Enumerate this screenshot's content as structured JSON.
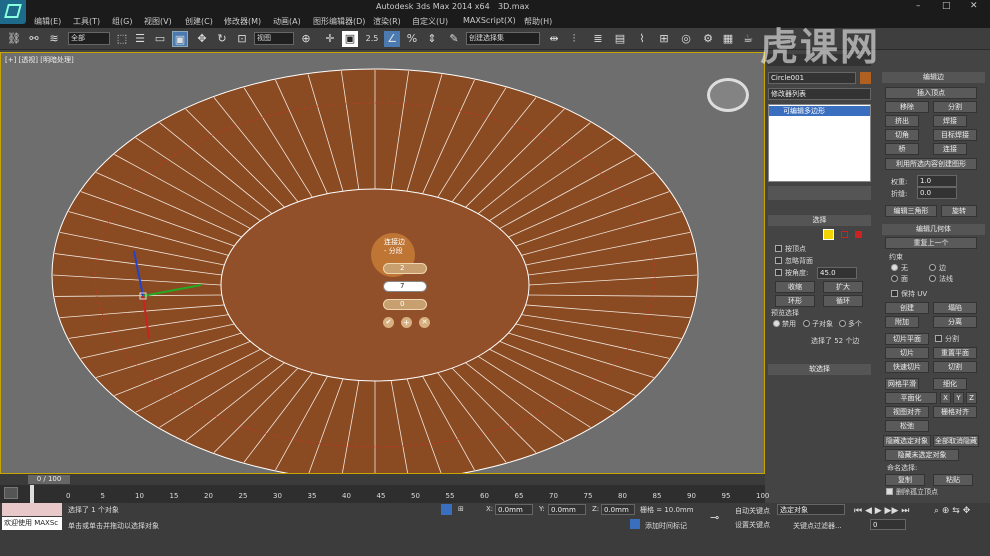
{
  "titlebar": {
    "app": "Autodesk 3ds Max  2014 x64",
    "file": "3D.max",
    "minimize": "–",
    "maximize": "□",
    "close": "✕"
  },
  "menu": [
    "编辑(E)",
    "工具(T)",
    "组(G)",
    "视图(V)",
    "创建(C)",
    "修改器(M)",
    "动画(A)",
    "图形编辑器(D)",
    "渲染(R)",
    "自定义(U)",
    "MAXScript(X)",
    "帮助(H)"
  ],
  "toolbar": {
    "filter": "全部",
    "refcoord": "视图",
    "named_sel": "创建选择集",
    "snap_label": "2.5",
    "pct": "%"
  },
  "viewport": {
    "label": "[+] [透视] [明暗处理]"
  },
  "caddy": {
    "title1": "连接边",
    "title2": "- 分段",
    "seg": "2",
    "pinch": "7",
    "slide": "0"
  },
  "rpanel": {
    "objname": "Circle001",
    "modlist": "修改器列表",
    "stack_item": "可编辑多边形",
    "rollout_select": "选择",
    "by_vertex": "按顶点",
    "ignore_back": "忽略背面",
    "by_angle": "按角度:",
    "angle": "45.0",
    "shrink": "收缩",
    "grow": "扩大",
    "ring": "环形",
    "loop": "循环",
    "preview": "预览选择",
    "disabled": "禁用",
    "subobj": "子对象",
    "multi": "多个",
    "selected": "选择了 52 个边",
    "soft": "软选择",
    "edit_edges": "编辑边",
    "insert_vertex": "插入顶点",
    "remove": "移除",
    "split": "分割",
    "extrude": "挤出",
    "weld": "焊接",
    "chamfer": "切角",
    "target_weld": "目标焊接",
    "bridge": "桥",
    "connect": "连接",
    "create_shape": "利用所选内容创建图形",
    "weight": "权重:",
    "weight_v": "1.0",
    "crease": "折缝:",
    "crease_v": "0.0",
    "edit_tri": "编辑三角形",
    "turn": "旋转",
    "edit_geo": "编辑几何体",
    "repeat": "重复上一个",
    "constraint": "约束",
    "none": "无",
    "edge": "边",
    "face": "面",
    "normal": "法线",
    "preserve_uv": "保持 UV",
    "create": "创建",
    "collapse": "塌陷",
    "attach": "附加",
    "detach": "分离",
    "slice_plane": "切片平面",
    "split2": "分割",
    "slice": "切片",
    "reset_plane": "重置平面",
    "quickslice": "快速切片",
    "cut": "切割",
    "meshsmooth": "网格平滑",
    "tessellate": "细化",
    "planarize": "平面化",
    "x": "X",
    "y": "Y",
    "z": "Z",
    "view_align": "视图对齐",
    "grid_align": "栅格对齐",
    "relax": "松弛",
    "hide_sel": "隐藏选定对象",
    "unhide_all": "全部取消隐藏",
    "hide_unsel": "隐藏未选定对象",
    "named_sel": "命名选择:",
    "copy": "复制",
    "paste": "粘贴",
    "del_iso": "删除孤立顶点"
  },
  "timeline": {
    "frame": "0 / 100",
    "ticks": [
      "0",
      "5",
      "10",
      "15",
      "20",
      "25",
      "30",
      "35",
      "40",
      "45",
      "50",
      "55",
      "60",
      "65",
      "70",
      "75",
      "80",
      "85",
      "90",
      "95",
      "100"
    ]
  },
  "status": {
    "welcome": "欢迎使用 MAXSc",
    "line1": "选择了 1 个对象",
    "line2": "单击或单击并拖动以选择对象",
    "x_label": "X:",
    "x": "0.0mm",
    "y_label": "Y:",
    "y": "0.0mm",
    "z_label": "Z:",
    "z": "0.0mm",
    "grid": "栅格 = 10.0mm",
    "autokey": "自动关键点",
    "setkey": "设置关键点",
    "sel_obj": "选定对象",
    "add_tag": "添加时间标记",
    "key_filter": "关键点过滤器...",
    "frame": "0"
  },
  "watermark": "虎课网"
}
